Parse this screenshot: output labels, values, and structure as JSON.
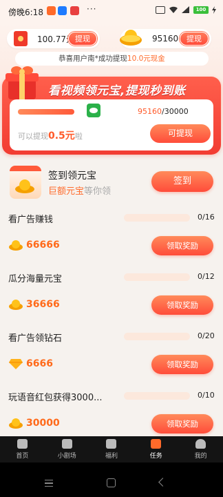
{
  "status_bar": {
    "time": "傍晚6:18",
    "dots": "···",
    "battery": "100"
  },
  "wallet": {
    "cash": "100.77元",
    "cash_button": "提现",
    "coins": "95160",
    "coins_button": "提现"
  },
  "notice": {
    "prefix": "恭喜用户南*成功提现",
    "amount": "10.0元现金"
  },
  "banner": {
    "title": "看视频领元宝,提现秒到账",
    "progress_current": "95160",
    "progress_total": "/30000",
    "withdraw_prefix": "可以提现",
    "withdraw_amount": "0.5元",
    "withdraw_suffix": "啦",
    "withdraw_button": "可提现"
  },
  "checkin": {
    "title": "签到领元宝",
    "sub_highlight": "巨额元宝",
    "sub_rest": "等你领",
    "button": "签到"
  },
  "tasks": [
    {
      "title": "看广告赚钱",
      "count": "0/16",
      "reward": "66666",
      "reward_icon": "gold-ingot-icon",
      "button": "领取奖励"
    },
    {
      "title": "瓜分海量元宝",
      "count": "0/12",
      "reward": "36666",
      "reward_icon": "gold-ingot-icon",
      "button": "领取奖励"
    },
    {
      "title": "看广告领钻石",
      "count": "0/20",
      "reward": "6666",
      "reward_icon": "diamond-icon",
      "button": "领取奖励"
    },
    {
      "title": "玩语音红包获得3000...",
      "count": "0/10",
      "reward": "30000",
      "reward_icon": "gold-ingot-icon",
      "button": "领取奖励"
    }
  ],
  "tabbar": [
    {
      "label": "首页",
      "icon": "home-icon"
    },
    {
      "label": "小剧场",
      "icon": "theater-icon"
    },
    {
      "label": "福利",
      "icon": "gift-icon"
    },
    {
      "label": "任务",
      "icon": "task-icon",
      "active": true
    },
    {
      "label": "我的",
      "icon": "profile-icon"
    }
  ],
  "colors": {
    "accent": "#ff5a3a",
    "banner_red": "#f23c32",
    "reward_orange": "#ff6a1a",
    "tabbar_bg": "#141414"
  }
}
